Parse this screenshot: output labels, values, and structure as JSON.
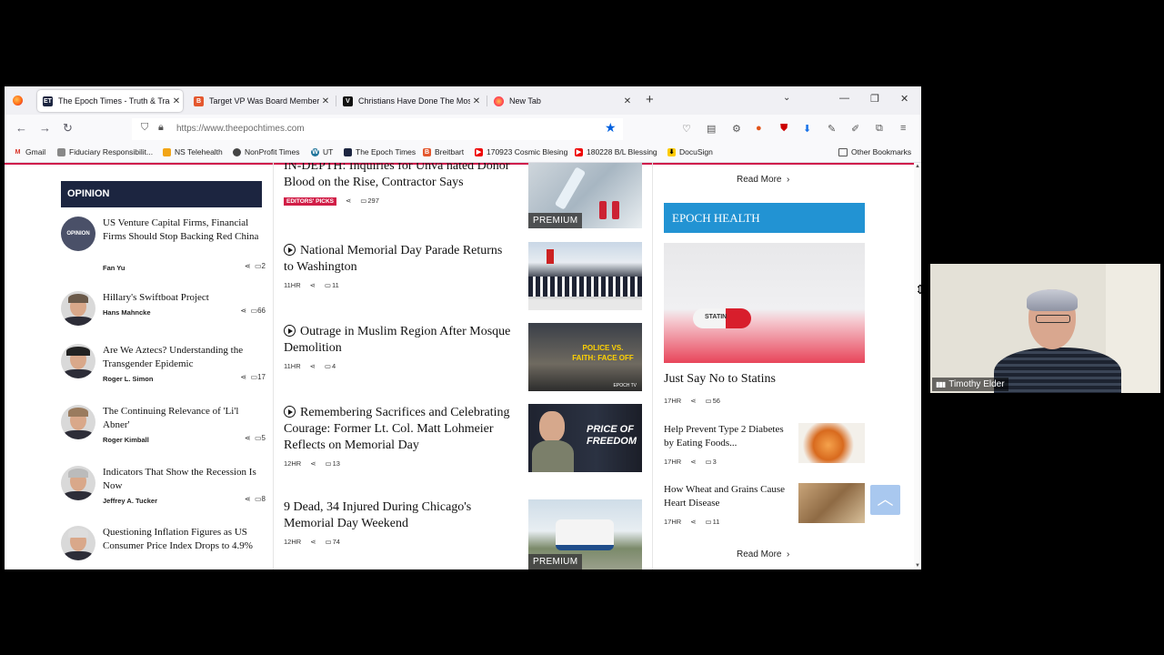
{
  "browser": {
    "tabs": [
      {
        "title": "The Epoch Times - Truth & Tradition",
        "favicon": "ET",
        "active": true
      },
      {
        "title": "Target VP Was Board Member for...",
        "favicon": "B",
        "active": false
      },
      {
        "title": "Christians Have Done The Most...",
        "favicon": "V",
        "active": false
      },
      {
        "title": "New Tab",
        "favicon": "firefox",
        "active": false
      }
    ],
    "url": "https://www.theepochtimes.com",
    "bookmarks": [
      "Gmail",
      "Fiduciary Responsibilit...",
      "NS Telehealth",
      "NonProfit Times",
      "UT",
      "The Epoch Times",
      "Breitbart",
      "170923 Cosmic Blesing",
      "180228 B/L Blessing",
      "DocuSign"
    ],
    "other_bookmarks": "Other Bookmarks"
  },
  "opinion": {
    "heading": "OPINION",
    "avatar_logo_text": "OPINION",
    "items": [
      {
        "title": "US Venture Capital Firms, Financial Firms Should Stop Backing Red China",
        "author": "Fan Yu",
        "comments": "2"
      },
      {
        "title": "Hillary's Swiftboat Project",
        "author": "Hans Mahncke",
        "comments": "66"
      },
      {
        "title": "Are We Aztecs? Understanding the Transgender Epidemic",
        "author": "Roger L. Simon",
        "comments": "17"
      },
      {
        "title": "The Continuing Relevance of 'Li'l Abner'",
        "author": "Roger Kimball",
        "comments": "5"
      },
      {
        "title": "Indicators That Show the Recession Is Now",
        "author": "Jeffrey A. Tucker",
        "comments": "8"
      },
      {
        "title": "Questioning Inflation Figures as US Consumer Price Index Drops to 4.9%",
        "author": "",
        "comments": ""
      }
    ]
  },
  "middle": {
    "items": [
      {
        "title": "IN-DEPTH: Inquiries for Unva  nated Donor Blood on the Rise, Contractor Says",
        "badge": "EDITORS' PICKS",
        "time": "",
        "comments": "297",
        "premium": "PREMIUM",
        "video": false
      },
      {
        "title": "National Memorial Day Parade Returns to Washington",
        "badge": "",
        "time": "11HR",
        "comments": "11",
        "premium": "",
        "video": true
      },
      {
        "title": "Outrage in Muslim Region After Mosque Demolition",
        "badge": "",
        "time": "11HR",
        "comments": "4",
        "premium": "",
        "video": true,
        "thumb_text": "POLICE VS. FAITH: FACE OFF",
        "thumb_sub": "EPOCH TV"
      },
      {
        "title": "Remembering Sacrifices and Celebrating Courage: Former Lt. Col. Matt Lohmeier Reflects on Memorial Day",
        "badge": "",
        "time": "12HR",
        "comments": "13",
        "premium": "",
        "video": true,
        "thumb_text": "PRICE OF FREEDOM"
      },
      {
        "title": "9 Dead, 34 Injured During Chicago's Memorial Day Weekend",
        "badge": "",
        "time": "12HR",
        "comments": "74",
        "premium": "PREMIUM",
        "video": false
      }
    ]
  },
  "right": {
    "read_more": "Read More",
    "health_heading": "EPOCH HEALTH",
    "pill_label": "STATIN",
    "main": {
      "title": "Just Say No to Statins",
      "time": "17HR",
      "comments": "56"
    },
    "items": [
      {
        "title": "Help Prevent Type 2 Diabetes by Eating Foods...",
        "time": "17HR",
        "comments": "3"
      },
      {
        "title": "How Wheat and Grains Cause Heart Disease",
        "time": "17HR",
        "comments": "11"
      }
    ]
  },
  "video_call": {
    "name": "Timothy Elder"
  }
}
